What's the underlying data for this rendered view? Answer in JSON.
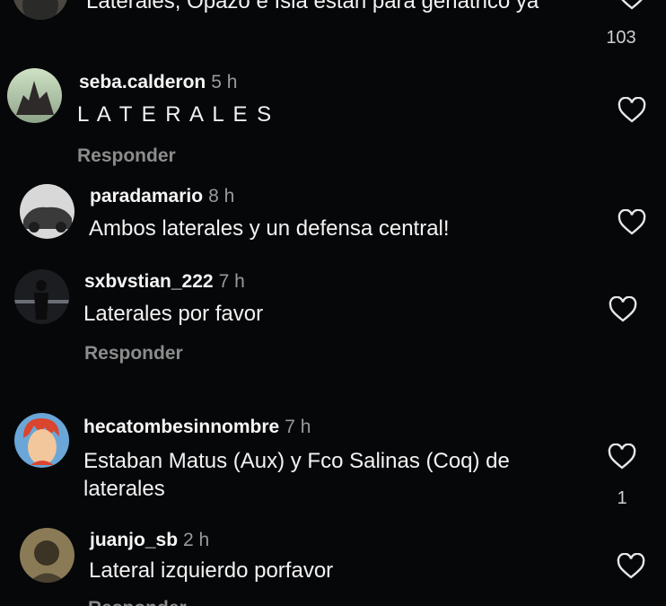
{
  "comments": [
    {
      "user": "",
      "time": "",
      "text": "Laterales, Opazo e Isla están para geriátrico ya",
      "likes": "103",
      "reply": ""
    },
    {
      "user": "seba.calderon",
      "time": "5 h",
      "text": "L A T E R A L E S",
      "likes": "",
      "reply": "Responder"
    },
    {
      "user": "paradamario",
      "time": "8 h",
      "text": "Ambos laterales y un defensa central!",
      "likes": "",
      "reply": ""
    },
    {
      "user": "sxbvstian_222",
      "time": "7 h",
      "text": "Laterales por favor",
      "likes": "",
      "reply": "Responder"
    },
    {
      "user": "hecatombesinnombre",
      "time": "7 h",
      "text": "Estaban Matus (Aux) y Fco Salinas (Coq) de laterales",
      "likes": "1",
      "reply": ""
    },
    {
      "user": "juanjo_sb",
      "time": "2 h",
      "text": "Lateral izquierdo porfavor",
      "likes": "",
      "reply": "Responder"
    }
  ],
  "colors": {
    "background": "#060709",
    "text": "#f2f2f2",
    "secondary": "#9a9a9a",
    "icon": "#e6e6e6"
  },
  "icons": [
    "heart-icon"
  ]
}
